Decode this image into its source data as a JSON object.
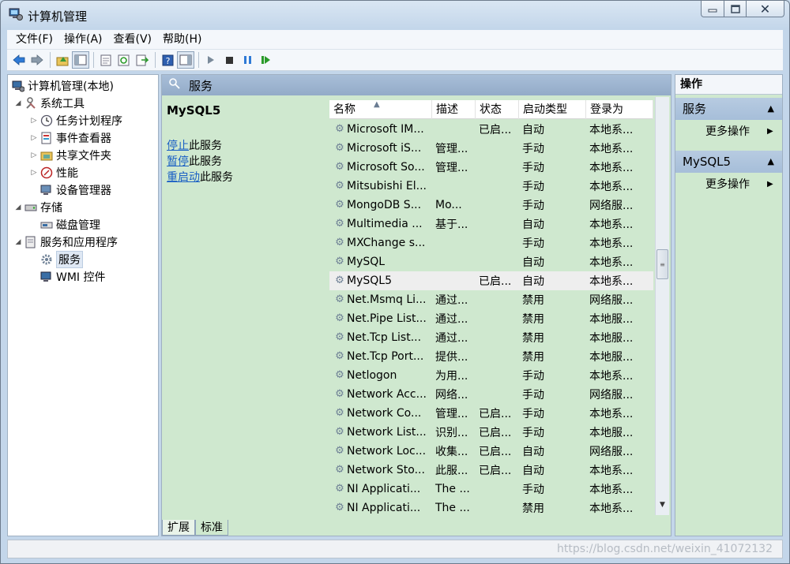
{
  "window": {
    "title": "计算机管理"
  },
  "menu": [
    "文件(F)",
    "操作(A)",
    "查看(V)",
    "帮助(H)"
  ],
  "toolbar": [
    "back-icon",
    "forward-icon",
    "up-folder-icon",
    "show-tree-icon",
    "properties-icon",
    "refresh-icon",
    "export-icon",
    "help-icon",
    "action-pane-icon",
    "play-icon",
    "stop-icon",
    "pause-icon",
    "restart-icon"
  ],
  "tree": {
    "root": "计算机管理(本地)",
    "system_tools": "系统工具",
    "task_scheduler": "任务计划程序",
    "event_viewer": "事件查看器",
    "shared_folders": "共享文件夹",
    "performance": "性能",
    "device_manager": "设备管理器",
    "storage": "存储",
    "disk_management": "磁盘管理",
    "services_apps": "服务和应用程序",
    "services": "服务",
    "wmi": "WMI 控件"
  },
  "middle": {
    "header": "服务",
    "detail_title": "MySQL5",
    "stop_link": "停止",
    "stop_suffix": "此服务",
    "pause_link": "暂停",
    "pause_suffix": "此服务",
    "restart_link": "重启动",
    "restart_suffix": "此服务",
    "columns": [
      "名称",
      "描述",
      "状态",
      "启动类型",
      "登录为"
    ],
    "rows": [
      [
        "Microsoft IM...",
        "",
        "已启...",
        "自动",
        "本地系..."
      ],
      [
        "Microsoft iS...",
        "管理...",
        "",
        "手动",
        "本地系..."
      ],
      [
        "Microsoft So...",
        "管理...",
        "",
        "手动",
        "本地系..."
      ],
      [
        "Mitsubishi El...",
        "",
        "",
        "手动",
        "本地系..."
      ],
      [
        "MongoDB S...",
        "Mo...",
        "",
        "手动",
        "网络服..."
      ],
      [
        "Multimedia ...",
        "基于...",
        "",
        "自动",
        "本地系..."
      ],
      [
        "MXChange s...",
        "",
        "",
        "手动",
        "本地系..."
      ],
      [
        "MySQL",
        "",
        "",
        "自动",
        "本地系..."
      ],
      [
        "MySQL5",
        "",
        "已启...",
        "自动",
        "本地系..."
      ],
      [
        "Net.Msmq Li...",
        "通过...",
        "",
        "禁用",
        "网络服..."
      ],
      [
        "Net.Pipe List...",
        "通过...",
        "",
        "禁用",
        "本地服..."
      ],
      [
        "Net.Tcp List...",
        "通过...",
        "",
        "禁用",
        "本地服..."
      ],
      [
        "Net.Tcp Port...",
        "提供...",
        "",
        "禁用",
        "本地服..."
      ],
      [
        "Netlogon",
        "为用...",
        "",
        "手动",
        "本地系..."
      ],
      [
        "Network Acc...",
        "网络...",
        "",
        "手动",
        "网络服..."
      ],
      [
        "Network Co...",
        "管理...",
        "已启...",
        "手动",
        "本地系..."
      ],
      [
        "Network List...",
        "识别...",
        "已启...",
        "手动",
        "本地服..."
      ],
      [
        "Network Loc...",
        "收集...",
        "已启...",
        "自动",
        "网络服..."
      ],
      [
        "Network Sto...",
        "此服...",
        "已启...",
        "自动",
        "本地系..."
      ],
      [
        "NI Applicati...",
        "The ...",
        "",
        "手动",
        "本地系..."
      ],
      [
        "NI Applicati...",
        "The ...",
        "",
        "禁用",
        "本地系..."
      ]
    ],
    "selected_row": "MySQL5",
    "tabs": [
      "扩展",
      "标准"
    ]
  },
  "actions": {
    "title": "操作",
    "section1": "服务",
    "section1_more": "更多操作",
    "section2": "MySQL5",
    "section2_more": "更多操作"
  },
  "status": {
    "watermark": "https://blog.csdn.net/weixin_41072132"
  }
}
